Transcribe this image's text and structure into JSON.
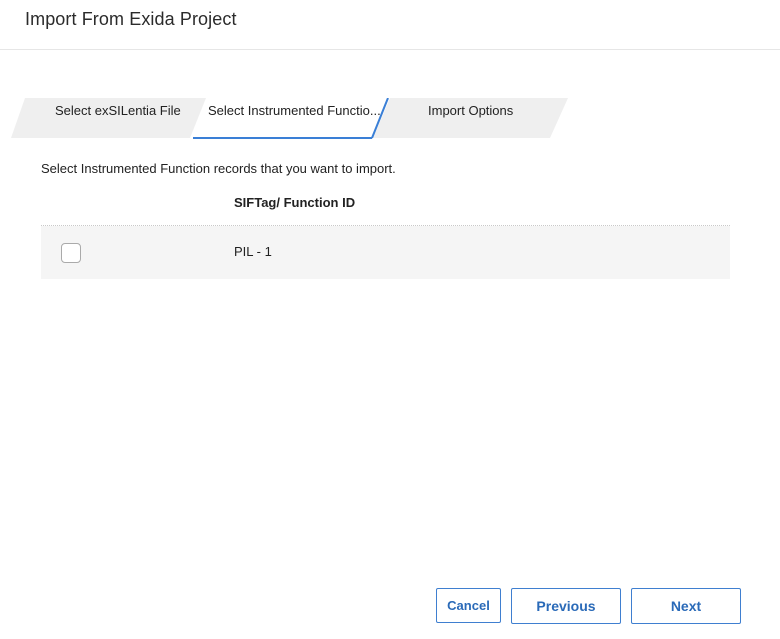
{
  "dialog": {
    "title": "Import From Exida Project"
  },
  "wizard": {
    "steps": [
      {
        "label": "Select exSILentia File",
        "active": false
      },
      {
        "label": "Select Instrumented Functio...",
        "active": true
      },
      {
        "label": "Import Options",
        "active": false
      }
    ],
    "active_color": "#3a7fd6",
    "inactive_color": "#efefef"
  },
  "instructions": "Select Instrumented Function records that you want to import.",
  "grid": {
    "column_header": "SIFTag/ Function ID",
    "rows": [
      {
        "checked": false,
        "value": "PIL - 1"
      }
    ]
  },
  "buttons": {
    "cancel": "Cancel",
    "previous": "Previous",
    "next": "Next"
  }
}
